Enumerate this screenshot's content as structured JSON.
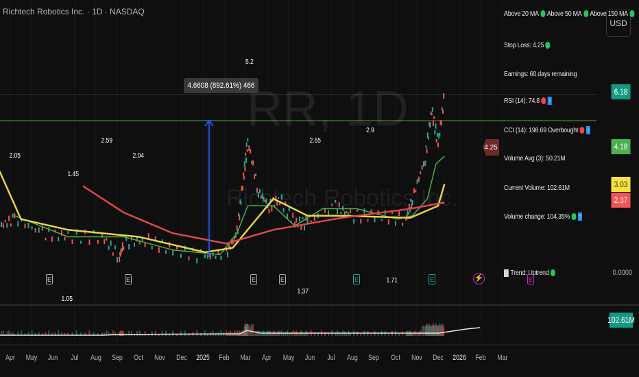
{
  "header": {
    "title": "Richtech Robotics Inc. · 1D · NASDAQ",
    "currency": "USD"
  },
  "watermark": {
    "symbol": "RR, 1D",
    "name": "Richtech Robotics Inc."
  },
  "info_panel": {
    "ma_20": "Above 20 MA",
    "ma_50": "Above 50 MA",
    "ma_150": "Above 150 MA",
    "stop_loss": "Stop Loss: 4.25",
    "earnings": "Earnings: 60 days remaining",
    "rsi": "RSI (14): 74.8",
    "cci": "CCI (14): 198.69 Overbought",
    "vol_avg": "Volume Avg (3): 50.21M",
    "cur_vol": "Current Volume: 102.61M",
    "vol_change": "Volume change: 104.35%",
    "trend": "Trend: Uptrend"
  },
  "price_labels": {
    "last": "6.18",
    "stop": "4.25",
    "ma20": "4.18",
    "ma50": "3.03",
    "ma150": "2.37",
    "indicator": "0.0000",
    "volume": "102.61M"
  },
  "measure": {
    "label": "4.6608 (892.61%) 466"
  },
  "pivots": [
    "2.05",
    "2.59",
    "1.45",
    "2.04",
    "5.2",
    "2.65",
    "2.9",
    "1.05",
    "1.37",
    "1.71"
  ],
  "events": {
    "earnings": "E",
    "dividend": "E"
  },
  "x_axis": [
    "Apr",
    "May",
    "Jun",
    "Jul",
    "Aug",
    "Sep",
    "Oct",
    "Nov",
    "Dec",
    "2025",
    "Feb",
    "Mar",
    "Apr",
    "May",
    "Jun",
    "Jul",
    "Aug",
    "Sep",
    "Oct",
    "Nov",
    "Dec",
    "2026",
    "Feb",
    "Mar"
  ],
  "colors": {
    "up": "#26a69a",
    "down": "#ef5350",
    "ma20": "#4caf50",
    "ma50": "#e6d44a",
    "ma150": "#e0474c",
    "accent": "#2962ff"
  },
  "chart_data": {
    "type": "line",
    "scale": "log",
    "x_unit": "months since Apr 2024",
    "price": {
      "t": [
        -0.5,
        0.2,
        1.5,
        2.7,
        4.3,
        5.1,
        5.3,
        6.3,
        7.6,
        9.1,
        10.1,
        10.6,
        10.9,
        11.1,
        11.6,
        12.1,
        12.6,
        13.3,
        13.9,
        15.2,
        15.9,
        17.2,
        18.5,
        18.8,
        19.4,
        19.7,
        20.0,
        20.3
      ],
      "close": [
        0.85,
        0.94,
        0.76,
        0.72,
        0.72,
        0.53,
        0.65,
        0.69,
        0.59,
        0.53,
        0.56,
        0.76,
        1.75,
        3.09,
        1.42,
        1.15,
        1.28,
        0.89,
        0.89,
        1.15,
        0.99,
        0.99,
        0.94,
        1.28,
        2.38,
        4.92,
        2.93,
        6.18
      ]
    },
    "series": [
      {
        "name": "MA 20",
        "t": [
          0.2,
          2.7,
          5.3,
          7.6,
          9.8,
          10.6,
          11.1,
          12.3,
          13.3,
          14.6,
          16.2,
          18.1,
          18.8,
          19.5,
          19.9,
          20.3
        ],
        "values": [
          0.99,
          0.72,
          0.72,
          0.59,
          0.55,
          0.76,
          1.15,
          1.15,
          0.85,
          1.1,
          1.1,
          0.94,
          0.99,
          1.28,
          2.17,
          2.43
        ]
      },
      {
        "name": "MA 50",
        "t": [
          -0.5,
          0.5,
          2.7,
          6.0,
          9.1,
          10.4,
          12.3,
          13.9,
          15.5,
          18.7,
          20.0,
          20.3
        ],
        "values": [
          1.94,
          0.94,
          0.8,
          0.72,
          0.57,
          0.61,
          1.28,
          0.99,
          0.99,
          0.96,
          1.15,
          1.6
        ]
      },
      {
        "name": "MA 150",
        "t": [
          3.4,
          5.3,
          7.6,
          10.1,
          12.3,
          15.5,
          18.7,
          20.3
        ],
        "values": [
          1.55,
          1.04,
          0.76,
          0.65,
          0.8,
          0.96,
          1.1,
          1.21
        ]
      }
    ]
  }
}
